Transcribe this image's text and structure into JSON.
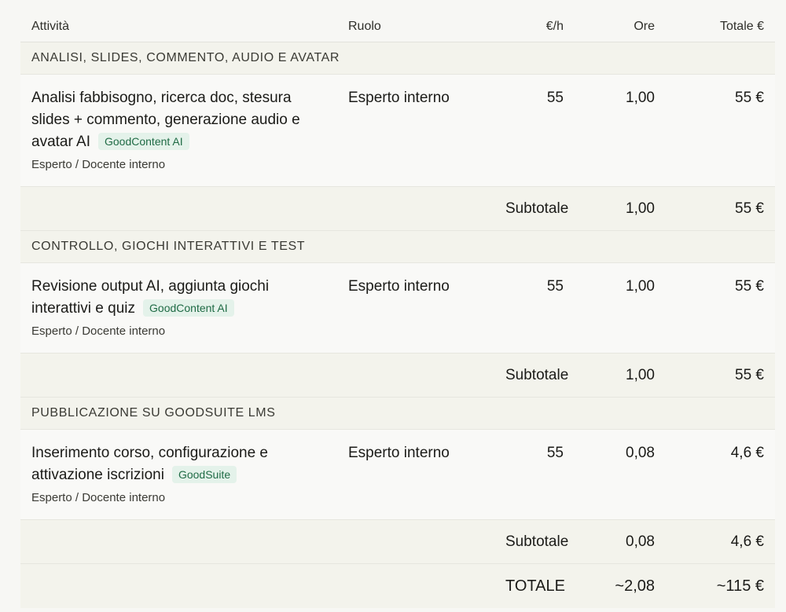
{
  "headers": {
    "activity": "Attività",
    "role": "Ruolo",
    "rate": "€/h",
    "hours": "Ore",
    "total": "Totale €"
  },
  "sections": [
    {
      "title": "ANALISI, SLIDES, COMMENTO, AUDIO E AVATAR",
      "item": {
        "activity": "Analisi fabbisogno, ricerca doc, stesura slides + commento, generazione audio e avatar AI",
        "tag": "GoodContent AI",
        "performer": "Esperto / Docente interno",
        "role": "Esperto interno",
        "rate": "55",
        "hours": "1,00",
        "total": "55 €"
      },
      "subtotal": {
        "label": "Subtotale",
        "hours": "1,00",
        "total": "55 €"
      }
    },
    {
      "title": "CONTROLLO, GIOCHI INTERATTIVI E TEST",
      "item": {
        "activity": "Revisione output AI, aggiunta giochi interattivi e quiz",
        "tag": "GoodContent AI",
        "performer": "Esperto / Docente interno",
        "role": "Esperto interno",
        "rate": "55",
        "hours": "1,00",
        "total": "55 €"
      },
      "subtotal": {
        "label": "Subtotale",
        "hours": "1,00",
        "total": "55 €"
      }
    },
    {
      "title": "PUBBLICAZIONE SU GOODSUITE LMS",
      "item": {
        "activity": "Inserimento corso, configurazione e attivazione iscrizioni",
        "tag": "GoodSuite",
        "performer": "Esperto / Docente interno",
        "role": "Esperto interno",
        "rate": "55",
        "hours": "0,08",
        "total": "4,6 €"
      },
      "subtotal": {
        "label": "Subtotale",
        "hours": "0,08",
        "total": "4,6 €"
      }
    }
  ],
  "grand_total": {
    "label": "TOTALE",
    "hours": "~2,08",
    "total": "~115 €"
  }
}
